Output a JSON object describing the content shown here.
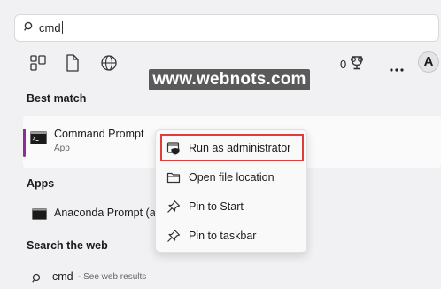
{
  "search": {
    "query": "cmd"
  },
  "toolbar": {
    "filters": [
      "all-apps-icon",
      "document-icon",
      "globe-icon"
    ],
    "rewards_count": "0",
    "avatar_letter": "A"
  },
  "watermark": "www.webnots.com",
  "best_match": {
    "heading": "Best match",
    "title": "Command Prompt",
    "subtitle": "App"
  },
  "apps": {
    "heading": "Apps",
    "items": [
      {
        "label": "Anaconda Prompt (ar"
      }
    ]
  },
  "web": {
    "heading": "Search the web",
    "term": "cmd",
    "hint": "- See web results"
  },
  "context_menu": {
    "items": [
      {
        "label": "Run as administrator",
        "icon": "shield-icon",
        "highlighted": true
      },
      {
        "label": "Open file location",
        "icon": "folder-icon"
      },
      {
        "label": "Pin to Start",
        "icon": "pin-icon"
      },
      {
        "label": "Pin to taskbar",
        "icon": "pin-icon"
      }
    ]
  },
  "colors": {
    "accent": "#8e2d92",
    "highlight_border": "#e13b3b",
    "watermark_bg": "#5a5a5a"
  }
}
